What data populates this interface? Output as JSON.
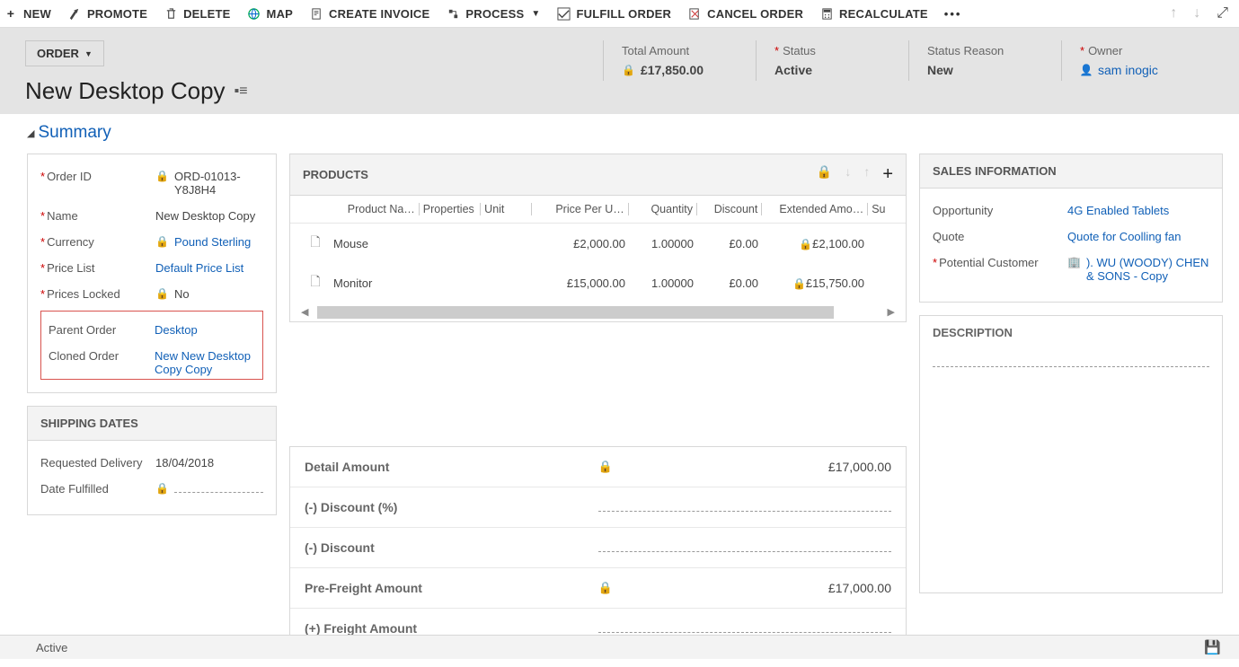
{
  "commands": {
    "new": "NEW",
    "promote": "PROMOTE",
    "delete": "DELETE",
    "map": "MAP",
    "create_invoice": "CREATE INVOICE",
    "process": "PROCESS",
    "fulfill_order": "FULFILL ORDER",
    "cancel_order": "CANCEL ORDER",
    "recalculate": "RECALCULATE"
  },
  "entity_label": "ORDER",
  "record_title": "New Desktop Copy",
  "header": {
    "total_amount": {
      "label": "Total Amount",
      "value": "£17,850.00"
    },
    "status": {
      "label": "Status",
      "value": "Active"
    },
    "status_reason": {
      "label": "Status Reason",
      "value": "New"
    },
    "owner": {
      "label": "Owner",
      "value": "sam inogic"
    }
  },
  "tab_title": "Summary",
  "details": {
    "order_id": {
      "label": "Order ID",
      "value": "ORD-01013-Y8J8H4"
    },
    "name": {
      "label": "Name",
      "value": "New Desktop Copy"
    },
    "currency": {
      "label": "Currency",
      "value": "Pound Sterling"
    },
    "price_list": {
      "label": "Price List",
      "value": "Default Price List"
    },
    "prices_locked": {
      "label": "Prices Locked",
      "value": "No"
    },
    "parent_order": {
      "label": "Parent Order",
      "value": "Desktop"
    },
    "cloned_order": {
      "label": "Cloned Order",
      "value": "New New Desktop Copy Copy"
    }
  },
  "shipping": {
    "title": "SHIPPING DATES",
    "requested_delivery": {
      "label": "Requested Delivery",
      "value": "18/04/2018"
    },
    "date_fulfilled": {
      "label": "Date Fulfilled"
    }
  },
  "products": {
    "title": "PRODUCTS",
    "columns": {
      "product_name": "Product Na…",
      "properties": "Properties",
      "unit": "Unit",
      "price_per_unit": "Price Per U…",
      "quantity": "Quantity",
      "discount": "Discount",
      "extended": "Extended Amo…",
      "su": "Su"
    },
    "rows": [
      {
        "name": "Mouse",
        "price": "£2,000.00",
        "qty": "1.00000",
        "discount": "£0.00",
        "extended": "£2,100.00"
      },
      {
        "name": "Monitor",
        "price": "£15,000.00",
        "qty": "1.00000",
        "discount": "£0.00",
        "extended": "£15,750.00"
      }
    ]
  },
  "summary": {
    "detail_amount": {
      "label": "Detail Amount",
      "value": "£17,000.00"
    },
    "discount_pct": {
      "label": "(-) Discount (%)"
    },
    "discount": {
      "label": "(-) Discount"
    },
    "pre_freight": {
      "label": "Pre-Freight Amount",
      "value": "£17,000.00"
    },
    "freight": {
      "label": "(+) Freight Amount"
    }
  },
  "sales_info": {
    "title": "SALES INFORMATION",
    "opportunity": {
      "label": "Opportunity",
      "value": "4G Enabled Tablets"
    },
    "quote": {
      "label": "Quote",
      "value": "Quote for Coolling fan"
    },
    "potential_customer": {
      "label": "Potential Customer",
      "value": "). WU (WOODY) CHEN & SONS - Copy"
    }
  },
  "description": {
    "title": "DESCRIPTION"
  },
  "footer_status": "Active"
}
